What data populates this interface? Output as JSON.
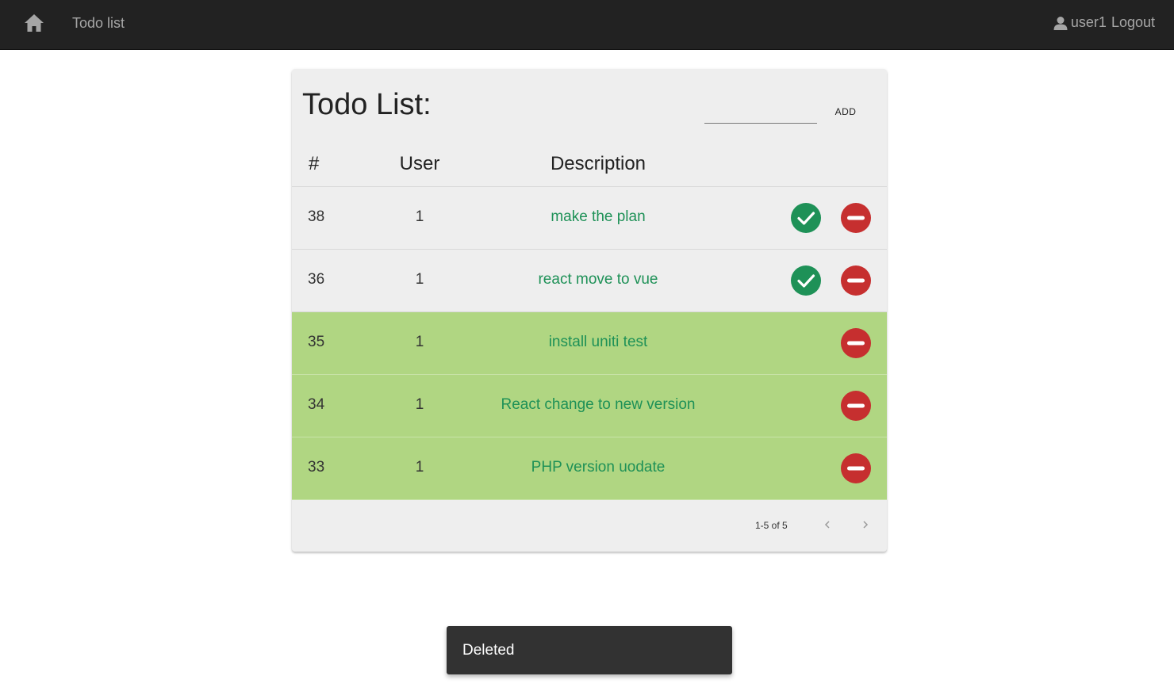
{
  "navbar": {
    "home_icon": "home-icon",
    "title": "Todo list",
    "user_icon": "user-icon",
    "username": "user1",
    "logout_label": "Logout"
  },
  "card": {
    "title": "Todo List:",
    "add_input": {
      "value": "",
      "placeholder": ""
    },
    "add_label": "ADD",
    "columns": {
      "num": "#",
      "user": "User",
      "description": "Description"
    },
    "rows": [
      {
        "id": "38",
        "user": "1",
        "description": "make the plan",
        "completed": false
      },
      {
        "id": "36",
        "user": "1",
        "description": "react move to vue",
        "completed": false
      },
      {
        "id": "35",
        "user": "1",
        "description": "install uniti test",
        "completed": true
      },
      {
        "id": "34",
        "user": "1",
        "description": "React change to new version",
        "completed": true
      },
      {
        "id": "33",
        "user": "1",
        "description": "PHP version uodate",
        "completed": true
      }
    ],
    "pagination": {
      "label": "1-5 of 5"
    }
  },
  "snackbar": {
    "message": "Deleted"
  },
  "colors": {
    "navbar_bg": "#222222",
    "card_bg": "#eeeeee",
    "completed_row_bg": "#b0d682",
    "description_text": "#1e9157",
    "check_button": "#1e9157",
    "delete_button": "#c62f2f",
    "snackbar_bg": "#323232"
  }
}
